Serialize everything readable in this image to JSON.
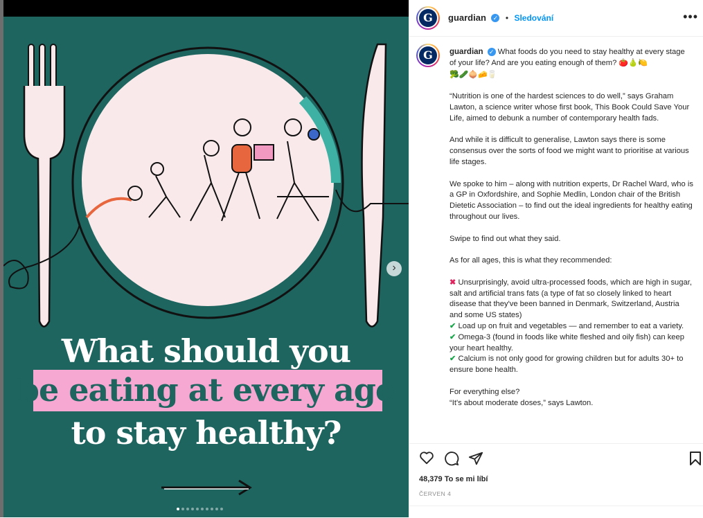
{
  "post": {
    "image": {
      "headline": {
        "line1": "What should you",
        "line2": "be eating at every age",
        "line3": "to stay healthy?"
      },
      "next_symbol": "›",
      "carousel_dots": 10,
      "carousel_active_index": 0
    },
    "header": {
      "username": "guardian",
      "verified_symbol": "✓",
      "separator": "•",
      "follow_label": "Sledování",
      "more_symbol": "•••",
      "avatar_letter": "G"
    },
    "caption": {
      "username": "guardian",
      "intro": "What foods do you need to stay healthy at every stage of your life? And are you eating enough of them? 🍅🍐🍋",
      "intro_emojis": "🥦🥒🧅🧀🥛",
      "paragraphs": [
        "“Nutrition is one of the hardest sciences to do well,” says Graham Lawton, a science writer whose first book, This Book Could Save Your Life, aimed to debunk a number of contemporary health fads.",
        "And while it is difficult to generalise, Lawton says there is some consensus over the sorts of food we might want to prioritise at various life stages.",
        "We spoke to him – along with nutrition experts, Dr Rachel Ward, who is a GP in Oxfordshire, and Sophie Medlin, London chair of the British Dietetic Association – to find out the ideal ingredients for healthy eating throughout our lives.",
        "Swipe to find out what they said.",
        "As for all ages, this is what they recommended:"
      ],
      "list": [
        {
          "mark": "✖",
          "kind": "x",
          "text": "Unsurprisingly, avoid ultra-processed foods, which are high in sugar, salt and artificial trans fats (a type of fat so closely linked to heart disease that they've been banned in Denmark, Switzerland, Austria and some US states)"
        },
        {
          "mark": "✔",
          "kind": "check",
          "text": "Load up on fruit and vegetables — and remember to eat a variety."
        },
        {
          "mark": "✔",
          "kind": "check",
          "text": "Omega-3 (found in foods like white fleshed and oily fish) can keep your heart healthy."
        },
        {
          "mark": "✔",
          "kind": "check",
          "text": "Calcium is not only good for growing children but for adults 30+ to ensure bone health."
        }
      ],
      "closing_1": "For everything else?",
      "closing_2": "“It's about moderate doses,” says Lawton."
    },
    "actions": {
      "likes": "48,379 To se mi líbí",
      "date": "ČERVEN 4"
    },
    "colors": {
      "background_green": "#1e645f",
      "highlight_pink": "#f6a8d3",
      "link_blue": "#0095f6"
    }
  }
}
